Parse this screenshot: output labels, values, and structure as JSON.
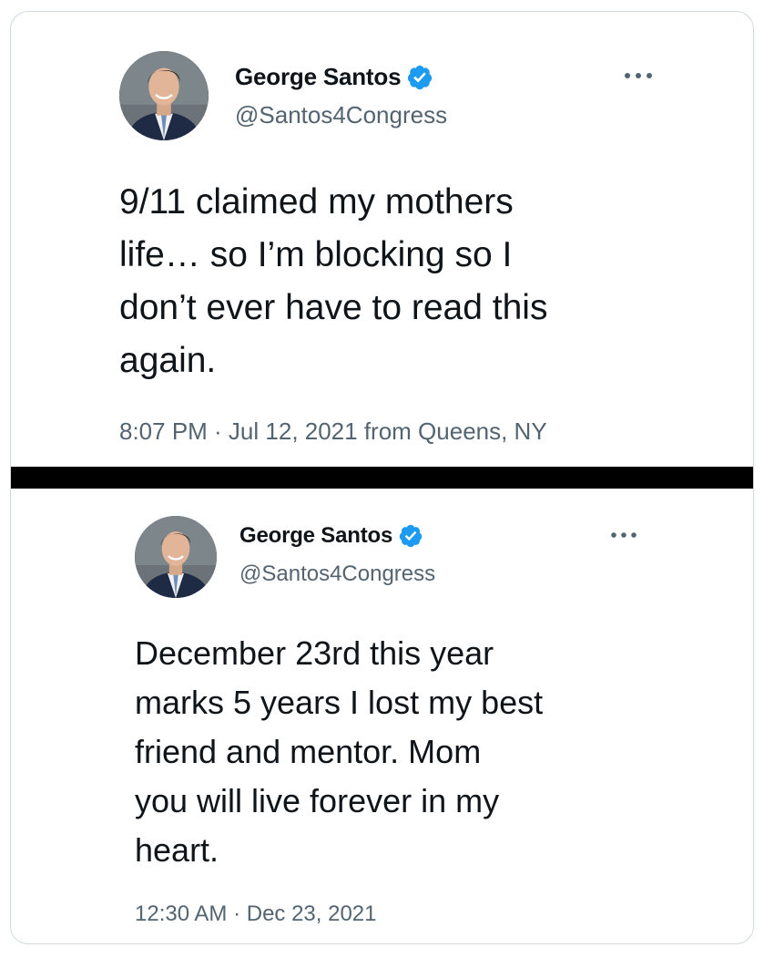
{
  "colors": {
    "text_primary": "#0f1419",
    "text_secondary": "#536471",
    "verified_blue": "#1d9bf0",
    "border": "#cfd9de",
    "divider": "#000000"
  },
  "tweets": [
    {
      "author": {
        "display_name": "George Santos",
        "handle": "@Santos4Congress",
        "verified_icon": "verified-badge-icon",
        "avatar": "profile-photo"
      },
      "more_icon": "more-options-icon",
      "text": "9/11 claimed my mothers\nlife… so I’m blocking so I\ndon’t ever have to read this\nagain.",
      "timestamp": "8:07 PM · Jul 12, 2021 from Queens, NY"
    },
    {
      "author": {
        "display_name": "George Santos",
        "handle": "@Santos4Congress",
        "verified_icon": "verified-badge-icon",
        "avatar": "profile-photo"
      },
      "more_icon": "more-options-icon",
      "text": "December 23rd this year\nmarks 5 years I lost my best\nfriend and mentor. Mom\nyou will live forever in my\nheart.",
      "timestamp": "12:30 AM · Dec 23, 2021"
    }
  ]
}
